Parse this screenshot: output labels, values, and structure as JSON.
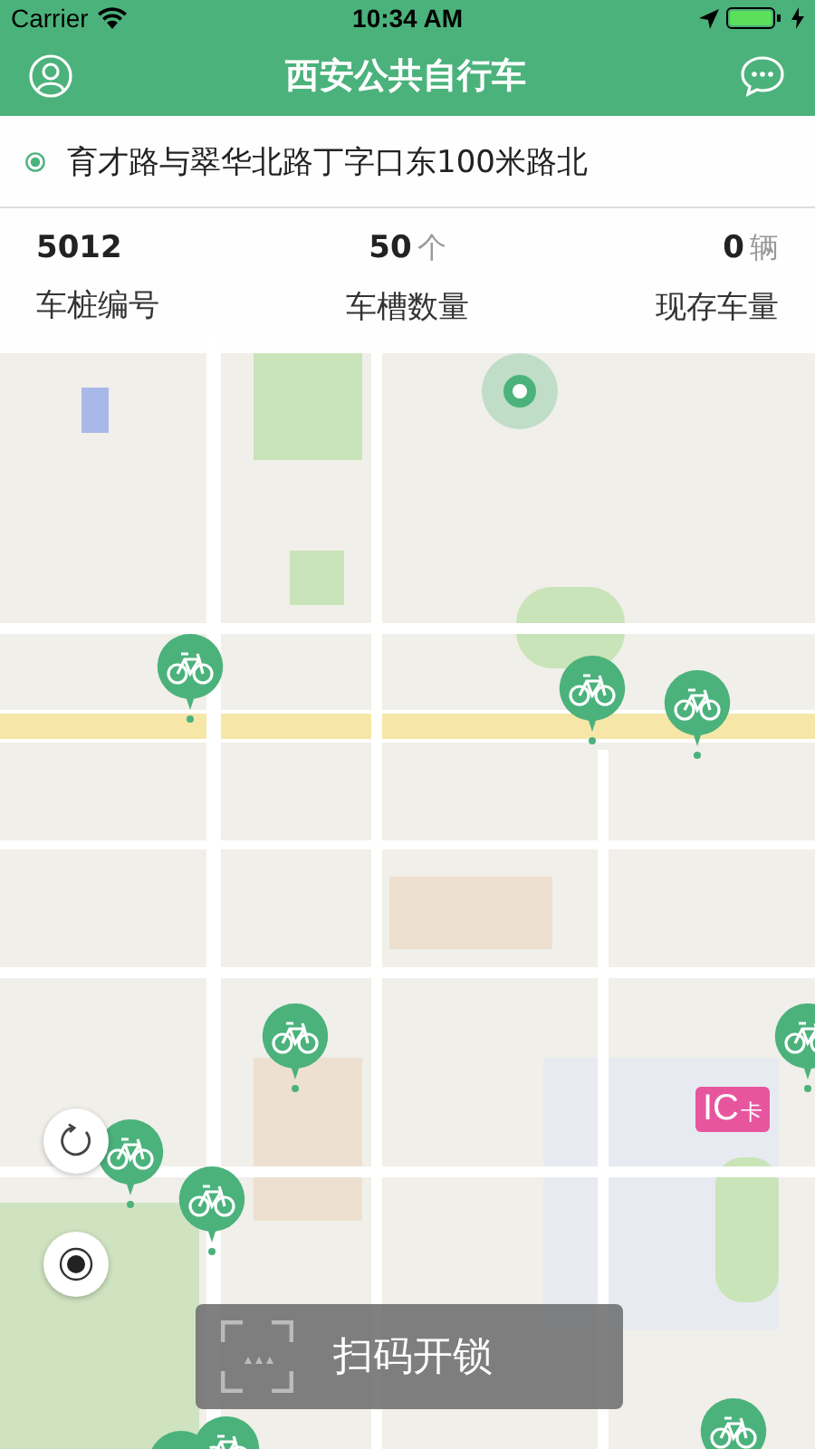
{
  "status_bar": {
    "carrier": "Carrier",
    "time": "10:34 AM"
  },
  "nav_bar": {
    "title": "西安公共自行车"
  },
  "station": {
    "address": "育才路与翠华北路丁字口东100米路北",
    "stats": [
      {
        "value": "5012",
        "label": "车桩编号"
      },
      {
        "value": "50",
        "unit": "个",
        "label": "车槽数量"
      },
      {
        "value": "0",
        "unit": "辆",
        "label": "现存车量"
      }
    ]
  },
  "ic_card_marker": {
    "label": "IC",
    "suffix": "卡"
  },
  "scan_button": {
    "label": "扫码开锁"
  }
}
